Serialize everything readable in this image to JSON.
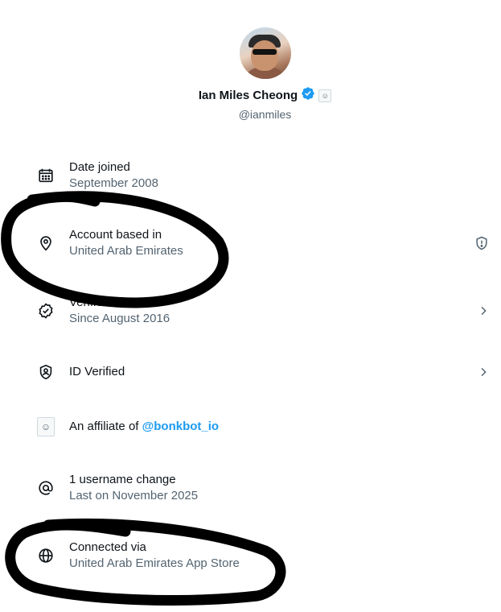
{
  "profile": {
    "name": "Ian Miles Cheong",
    "handle": "@ianmiles"
  },
  "rows": [
    {
      "title": "Date joined",
      "subtitle": "September 2008",
      "icon": "calendar-icon"
    },
    {
      "title": "Account based in",
      "subtitle": "United Arab Emirates",
      "icon": "location-pin-icon",
      "right_icon": "shield-alert-icon"
    },
    {
      "title": "Verified",
      "subtitle": "Since August 2016",
      "icon": "verified-badge-icon",
      "right_icon": "chevron-right-icon"
    },
    {
      "title": "ID Verified",
      "icon": "id-shield-icon",
      "right_icon": "chevron-right-icon"
    },
    {
      "title_prefix": "An affiliate of ",
      "link": "@bonkbot_io",
      "icon": "affiliate-logo-icon"
    },
    {
      "title": "1 username change",
      "subtitle": "Last on November 2025",
      "icon": "at-sign-icon"
    },
    {
      "title": "Connected via",
      "subtitle": "United Arab Emirates App Store",
      "icon": "globe-icon"
    }
  ],
  "colors": {
    "primary_text": "#0f1419",
    "secondary_text": "#536471",
    "link": "#1d9bf0",
    "verified_badge": "#1d9bf0",
    "annotation_marker": "#000000"
  }
}
